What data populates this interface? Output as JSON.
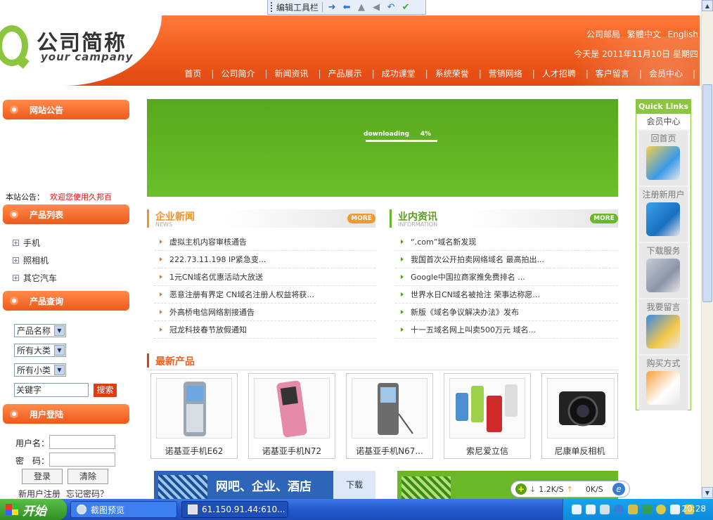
{
  "toolbar": {
    "label": "编辑工具栏"
  },
  "header": {
    "logo_cn": "公司简称",
    "logo_en": "your campany",
    "top_links": [
      "公司邮局",
      "繁體中文",
      "English"
    ],
    "date": "今天是 2011年11月10日 星期四",
    "nav": [
      "首页",
      "公司简介",
      "新闻资讯",
      "产品展示",
      "成功课堂",
      "系统荣誉",
      "营销网络",
      "人才招聘",
      "客户留言",
      "会员中心"
    ]
  },
  "sidebar": {
    "notice_title": "网站公告",
    "notice_label": "本站公告：",
    "notice_text": "欢迎您使用久邦百",
    "products_title": "产品列表",
    "categories": [
      "手机",
      "照相机",
      "其它汽车"
    ],
    "query_title": "产品查询",
    "selects": [
      "产品名称",
      "所有大类",
      "所有小类"
    ],
    "keyword_value": "关键字",
    "search_label": "搜索",
    "login_title": "用户登陆",
    "username_label": "用户名：",
    "password_label": "密　码：",
    "login_label": "登录",
    "clear_label": "清除",
    "register_label": "新用户注册",
    "forgot_label": "忘记密码？"
  },
  "banner": {
    "loading_text": "downloading",
    "percent": "4%"
  },
  "news": {
    "title": "企业新闻",
    "subtitle": "NEWS",
    "more": "MORE",
    "items": [
      "虚拟主机内容审核通告",
      "222.73.11.198 IP紧急变...",
      "1元CN域名优惠活动大放送",
      "恶意注册有界定 CN域名注册人权益将获...",
      "外高桥电信网络割接通告",
      "冠龙科技春节放假通知"
    ]
  },
  "industry": {
    "title": "业内资讯",
    "subtitle": "INFORMATION",
    "more": "MORE",
    "items": [
      "“.com”域名新发现",
      "我国首次公开拍卖网络域名 最高拍出...",
      "Google中国拉商家推免费排名 ...",
      "世界水日CN域名被抢注 荣事达称愿...",
      "新版《域名争议解决办法》发布",
      "十一五域名网上叫卖500万元 域名..."
    ]
  },
  "products": {
    "title": "最新产品",
    "items": [
      "诺基亚手机E62",
      "诺基亚手机N72",
      "诺基亚手机N67...",
      "索尼爱立信",
      "尼康单反相机"
    ]
  },
  "ads": {
    "ad1_text": "网吧、企业、酒店",
    "ad1_download": "下载"
  },
  "speed": {
    "down": "1.2K/S",
    "up": "0K/S"
  },
  "quick": {
    "title": "Quick Links",
    "member": "会员中心",
    "items": [
      "回首页",
      "注册新用户",
      "下载服务",
      "我要留言",
      "购买方式"
    ]
  },
  "taskbar": {
    "start": "开始",
    "tasks": [
      "截图预览",
      "61.150.91.44:610..."
    ],
    "clock": "20:28"
  }
}
